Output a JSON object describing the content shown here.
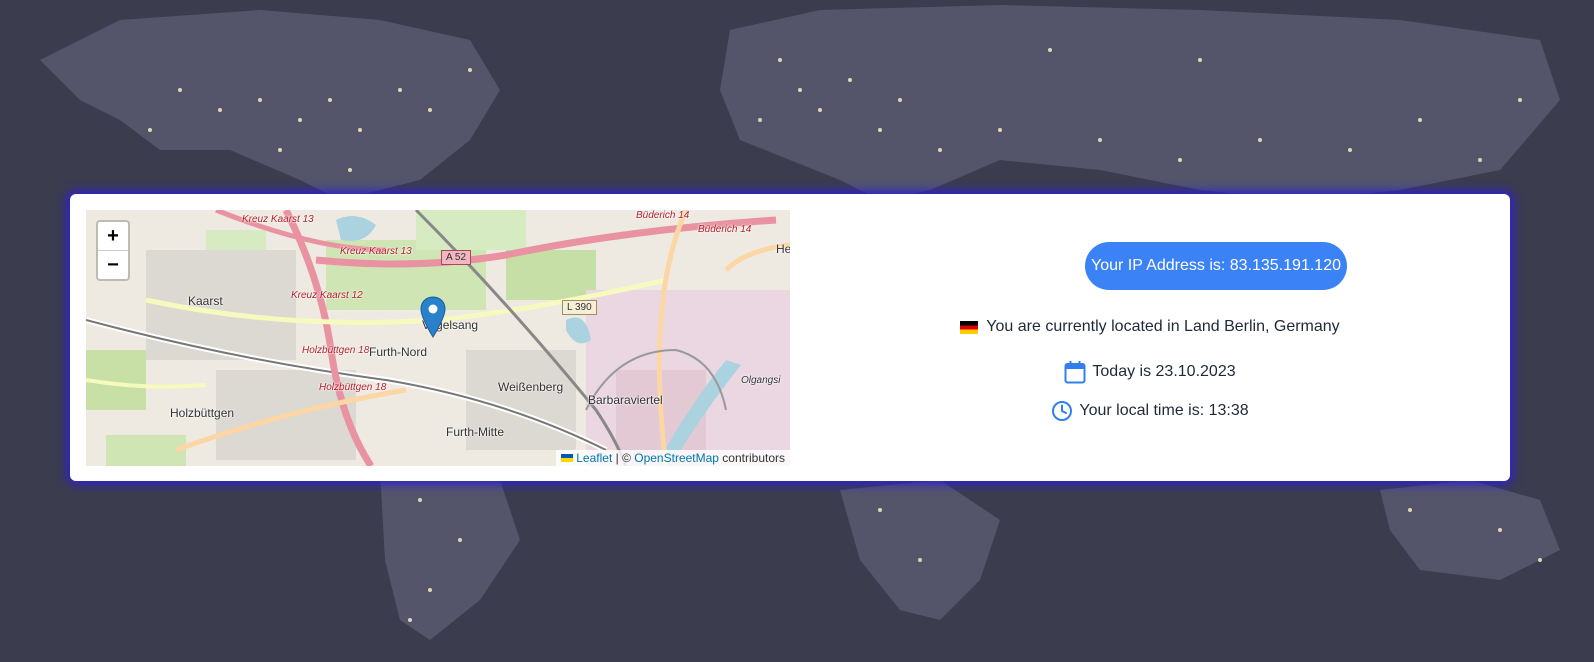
{
  "map": {
    "zoom_in_label": "+",
    "zoom_out_label": "−",
    "places": [
      "Kaarst",
      "Vogelsang",
      "Furth-Nord",
      "Weißenberg",
      "Holzbüttgen",
      "Furth-Mitte",
      "Barbaraviertel",
      "Olgangsi",
      "He"
    ],
    "road_labels": [
      "Kreuz Kaarst 13",
      "Kreuz Kaarst 13",
      "Kreuz Kaarst 12",
      "Holzbüttgen 18",
      "Holzbüttgen 18",
      "Büderich 14",
      "Büderich 14"
    ],
    "shields": [
      "A 52",
      "L 390"
    ],
    "attribution": {
      "leaflet": "Leaflet",
      "separator": " | © ",
      "osm": "OpenStreetMap",
      "suffix": " contributors"
    }
  },
  "info": {
    "ip_text": "Your IP Address is: 83.135.191.120",
    "location_text": "You are currently located in Land Berlin, Germany",
    "date_text": "Today is 23.10.2023",
    "time_text": "Your local time is: 13:38"
  },
  "colors": {
    "accent": "#3b82f6",
    "card_glow": "#2d1fd6",
    "background": "#3b3c4e"
  },
  "icons": {
    "flag": "germany-flag-icon",
    "calendar": "calendar-icon",
    "clock": "clock-icon",
    "marker": "map-marker-icon"
  }
}
